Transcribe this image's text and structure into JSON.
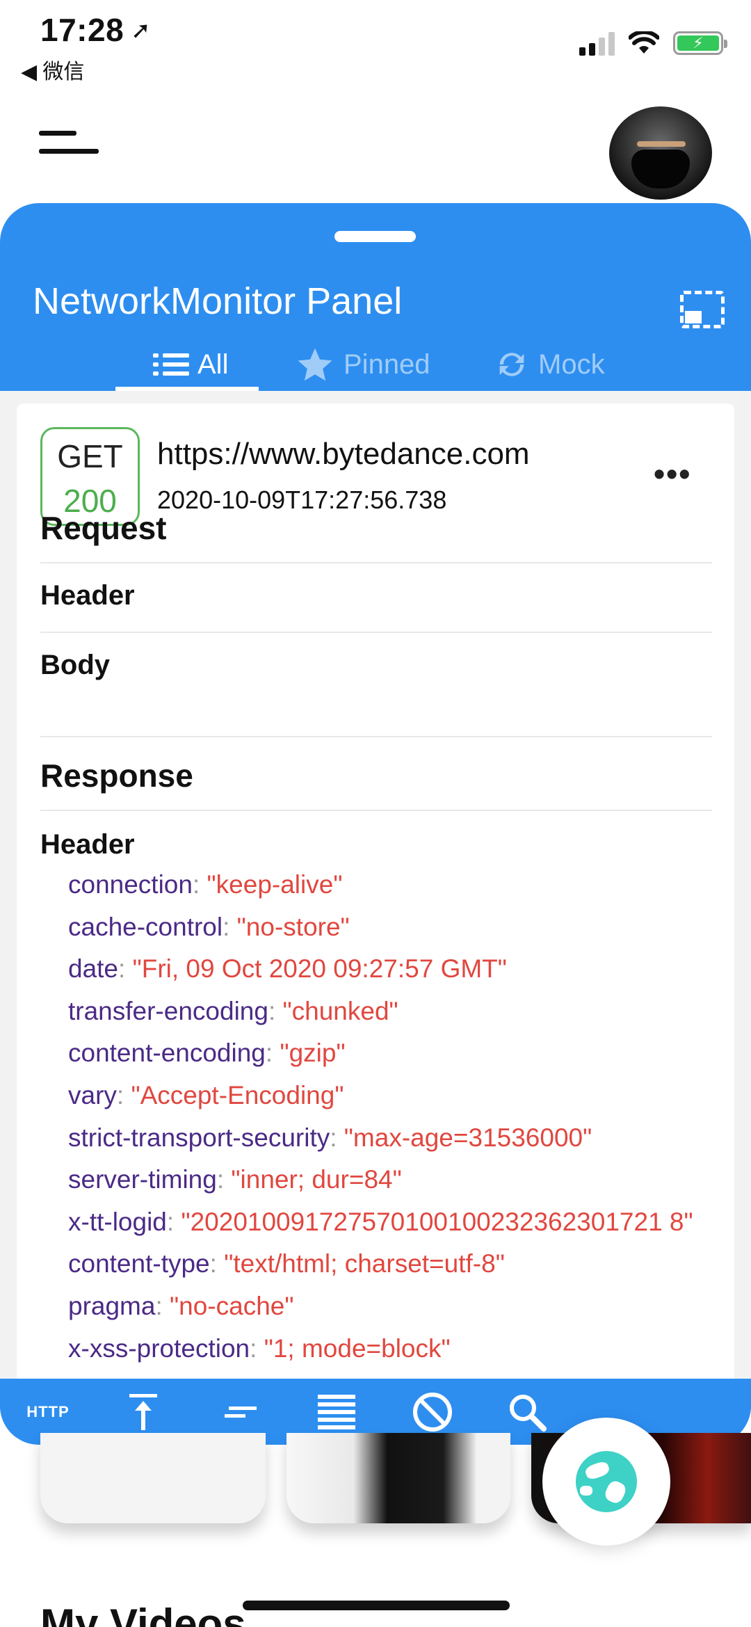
{
  "status_bar": {
    "time": "17:28",
    "back_label": "◀ 微信"
  },
  "panel": {
    "title": "NetworkMonitor Panel",
    "tabs": [
      {
        "label": "All",
        "icon": "list-icon"
      },
      {
        "label": "Pinned",
        "icon": "star-icon"
      },
      {
        "label": "Mock",
        "icon": "refresh-icon"
      }
    ]
  },
  "request_entry": {
    "method": "GET",
    "status_code": "200",
    "url": "https://www.bytedance.com",
    "timestamp": "2020-10-09T17:27:56.738",
    "more_label": "•••"
  },
  "detail": {
    "request_title": "Request",
    "request_header_label": "Header",
    "request_body_label": "Body",
    "response_title": "Response",
    "response_header_label": "Header",
    "response_headers": [
      {
        "key": "connection",
        "value": "\"keep-alive\""
      },
      {
        "key": "cache-control",
        "value": "\"no-store\""
      },
      {
        "key": "date",
        "value": "\"Fri, 09 Oct 2020 09:27:57 GMT\""
      },
      {
        "key": "transfer-encoding",
        "value": "\"chunked\""
      },
      {
        "key": "content-encoding",
        "value": "\"gzip\""
      },
      {
        "key": "vary",
        "value": "\"Accept-Encoding\""
      },
      {
        "key": "strict-transport-security",
        "value": "\"max-age=31536000\""
      },
      {
        "key": "server-timing",
        "value": "\"inner; dur=84\""
      },
      {
        "key": "x-tt-logid",
        "value": "\"202010091727570100100232362301721 8\""
      },
      {
        "key": "content-type",
        "value": "\"text/html; charset=utf-8\""
      },
      {
        "key": "pragma",
        "value": "\"no-cache\""
      },
      {
        "key": "x-xss-protection",
        "value": "\"1; mode=block\""
      }
    ]
  },
  "toolbar": {
    "http_label": "HTTP"
  },
  "background_app": {
    "section_title": "My Videos"
  },
  "colors": {
    "accent": "#2d8ef0",
    "success": "#4cae4c",
    "header_key": "#4b2a86",
    "header_value": "#e0473f"
  }
}
